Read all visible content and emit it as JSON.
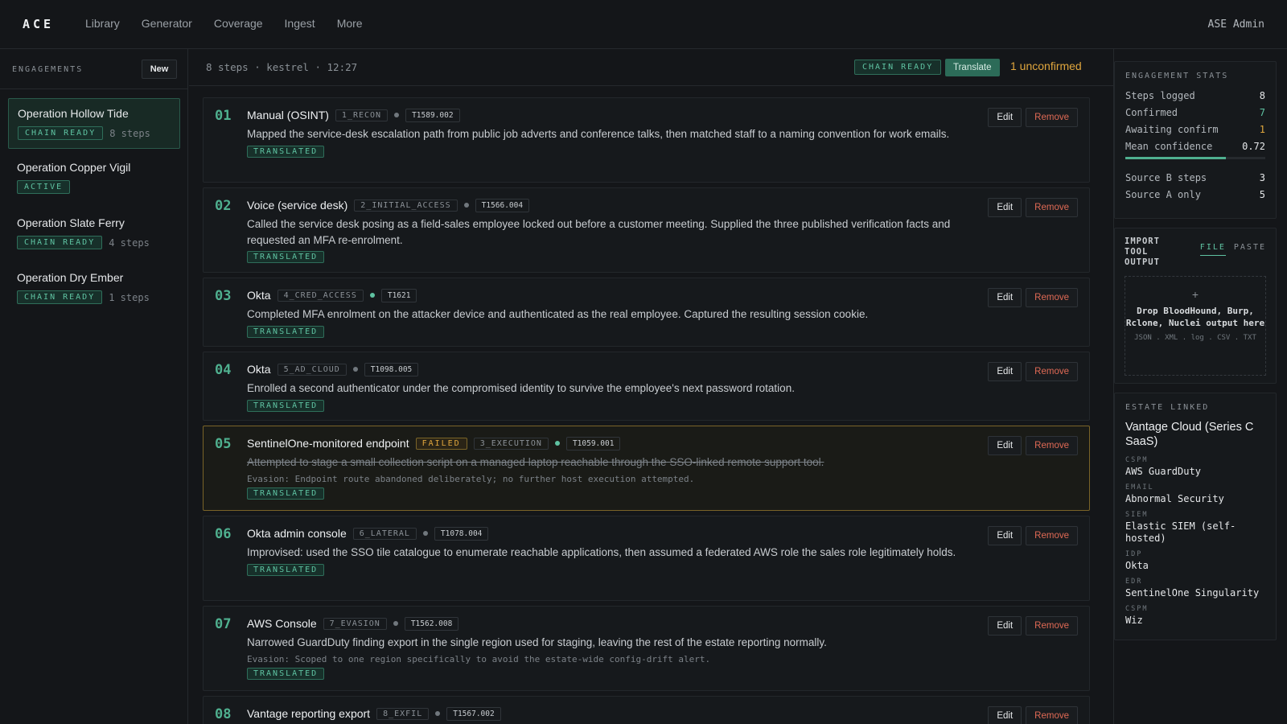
{
  "app": {
    "logo": "ACE",
    "user": "ASE Admin"
  },
  "nav": [
    "Library",
    "Generator",
    "Coverage",
    "Ingest",
    "More"
  ],
  "sidebar": {
    "title": "ENGAGEMENTS",
    "new_label": "New",
    "items": [
      {
        "name": "Operation Hollow Tide",
        "status": "CHAIN READY",
        "steps": "8 steps"
      },
      {
        "name": "Operation Copper Vigil",
        "status": "ACTIVE",
        "steps": ""
      },
      {
        "name": "Operation Slate Ferry",
        "status": "CHAIN READY",
        "steps": "4 steps"
      },
      {
        "name": "Operation Dry Ember",
        "status": "CHAIN READY",
        "steps": "1 steps"
      }
    ]
  },
  "main": {
    "crumb": "8 steps · kestrel · 12:27",
    "chain_status": "CHAIN READY",
    "translate_label": "Translate",
    "unconfirmed": "1 unconfirmed",
    "edit_label": "Edit",
    "remove_label": "Remove",
    "translated_label": "TRANSLATED",
    "steps": [
      {
        "num": "01",
        "title": "Manual (OSINT)",
        "phase": "1_RECON",
        "technique": "T1589.002",
        "confirmed": false,
        "desc": "Mapped the service-desk escalation path from public job adverts and conference talks, then matched staff to a naming convention for work emails."
      },
      {
        "num": "02",
        "title": "Voice (service desk)",
        "phase": "2_INITIAL_ACCESS",
        "technique": "T1566.004",
        "confirmed": false,
        "desc": "Called the service desk posing as a field-sales employee locked out before a customer meeting. Supplied the three published verification facts and requested an MFA re-enrolment."
      },
      {
        "num": "03",
        "title": "Okta",
        "phase": "4_CRED_ACCESS",
        "technique": "T1621",
        "confirmed": true,
        "desc": "Completed MFA enrolment on the attacker device and authenticated as the real employee. Captured the resulting session cookie."
      },
      {
        "num": "04",
        "title": "Okta",
        "phase": "5_AD_CLOUD",
        "technique": "T1098.005",
        "confirmed": false,
        "desc": "Enrolled a second authenticator under the compromised identity to survive the employee's next password rotation."
      },
      {
        "num": "05",
        "title": "SentinelOne-monitored endpoint",
        "failed": "FAILED",
        "phase": "3_EXECUTION",
        "technique": "T1059.001",
        "confirmed": true,
        "desc": "Attempted to stage a small collection script on a managed laptop reachable through the SSO-linked remote support tool.",
        "evasion": "Evasion: Endpoint route abandoned deliberately; no further host execution attempted."
      },
      {
        "num": "06",
        "title": "Okta admin console",
        "phase": "6_LATERAL",
        "technique": "T1078.004",
        "confirmed": false,
        "desc": "Improvised: used the SSO tile catalogue to enumerate reachable applications, then assumed a federated AWS role the sales role legitimately holds."
      },
      {
        "num": "07",
        "title": "AWS Console",
        "phase": "7_EVASION",
        "technique": "T1562.008",
        "confirmed": false,
        "desc": "Narrowed GuardDuty finding export in the single region used for staging, leaving the rest of the estate reporting normally.",
        "evasion": "Evasion: Scoped to one region specifically to avoid the estate-wide config-drift alert."
      },
      {
        "num": "08",
        "title": "Vantage reporting export",
        "phase": "8_EXFIL",
        "technique": "T1567.002",
        "confirmed": false
      }
    ]
  },
  "stats": {
    "title": "ENGAGEMENT STATS",
    "rows": [
      {
        "label": "Steps logged",
        "value": "8"
      },
      {
        "label": "Confirmed",
        "value": "7"
      },
      {
        "label": "Awaiting confirm",
        "value": "1"
      },
      {
        "label": "Mean confidence",
        "value": "0.72"
      },
      {
        "label": "Source B steps",
        "value": "3"
      },
      {
        "label": "Source A only",
        "value": "5"
      }
    ],
    "confidence_fraction": 0.72,
    "accent": "#4fb08f",
    "warn": "#e0a63d"
  },
  "import": {
    "title_lines": [
      "IMPORT",
      "TOOL",
      "OUTPUT"
    ],
    "tabs": [
      "FILE",
      "PASTE"
    ],
    "plus": "+",
    "drop_text": "Drop BloodHound, Burp, Rclone, Nuclei output here",
    "formats": "JSON . XML . log . CSV . TXT"
  },
  "estate": {
    "title": "ESTATE LINKED",
    "name": "Vantage Cloud (Series C SaaS)",
    "items": [
      {
        "k": "CSPM",
        "v": "AWS GuardDuty"
      },
      {
        "k": "EMAIL",
        "v": "Abnormal Security"
      },
      {
        "k": "SIEM",
        "v": "Elastic SIEM (self-hosted)"
      },
      {
        "k": "IDP",
        "v": "Okta"
      },
      {
        "k": "EDR",
        "v": "SentinelOne Singularity"
      },
      {
        "k": "CSPM",
        "v": "Wiz"
      }
    ]
  }
}
